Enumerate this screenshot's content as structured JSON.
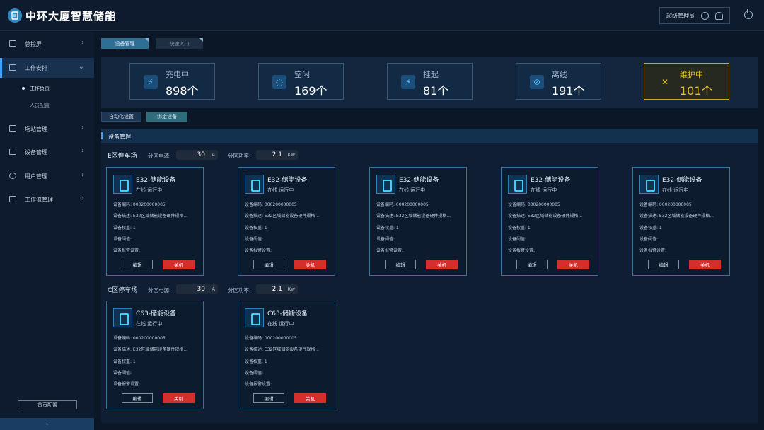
{
  "app": {
    "title": "中环大厦智慧储能"
  },
  "header": {
    "user_label": "超级管理员"
  },
  "sidebar": {
    "items": [
      {
        "label": "总控屏"
      },
      {
        "label": "工作安排"
      },
      {
        "label": "场站管理"
      },
      {
        "label": "设备管理"
      },
      {
        "label": "用户管理"
      },
      {
        "label": "工作流管理"
      }
    ],
    "subitems": [
      {
        "label": "工作负责"
      },
      {
        "label": "人员配置"
      }
    ],
    "home_config": "首页配置"
  },
  "tabs": [
    {
      "label": "设备管理"
    },
    {
      "label": "快速入口"
    }
  ],
  "stats": [
    {
      "label": "充电中",
      "value": "898个",
      "icon": "battery-charging-icon"
    },
    {
      "label": "空闲",
      "value": "169个",
      "icon": "idle-icon"
    },
    {
      "label": "挂起",
      "value": "81个",
      "icon": "suspend-icon"
    },
    {
      "label": "离线",
      "value": "191个",
      "icon": "offline-icon"
    },
    {
      "label": "维护中",
      "value": "101个",
      "icon": "maintenance-icon",
      "color": "#e0bc2a"
    }
  ],
  "actions": [
    {
      "label": "自动化设置"
    },
    {
      "label": "绑定设备"
    }
  ],
  "panel": {
    "title": "设备管理"
  },
  "zones": [
    {
      "name": "E区停车场",
      "power_source_label": "分区电源:",
      "power_source_value": "30",
      "power_source_unit": "A",
      "power_label": "分区功率:",
      "power_value": "2.1",
      "power_unit": "Kw",
      "devices": [
        {
          "name": "E32-储能设备",
          "status": "在线  运行中",
          "code": "设备编码: 000200000005",
          "desc": "设备描述: E32区域储能设备硬件规格...",
          "weight": "设备权重: 1",
          "threshold": "设备阈值:",
          "alarm": "设备报警设置:",
          "edit": "编辑",
          "off": "关机"
        },
        {
          "name": "E32-储能设备",
          "status": "在线  运行中",
          "code": "设备编码: 000200000005",
          "desc": "设备描述: E32区域储能设备硬件规格...",
          "weight": "设备权重: 1",
          "threshold": "设备阈值:",
          "alarm": "设备报警设置:",
          "edit": "编辑",
          "off": "关机"
        },
        {
          "name": "E32-储能设备",
          "status": "在线  运行中",
          "code": "设备编码: 000200000005",
          "desc": "设备描述: E32区域储能设备硬件规格...",
          "weight": "设备权重: 1",
          "threshold": "设备阈值:",
          "alarm": "设备报警设置:",
          "edit": "编辑",
          "off": "关机"
        },
        {
          "name": "E32-储能设备",
          "status": "在线  运行中",
          "code": "设备编码: 000200000005",
          "desc": "设备描述: E32区域储能设备硬件规格...",
          "weight": "设备权重: 1",
          "threshold": "设备阈值:",
          "alarm": "设备报警设置:",
          "edit": "编辑",
          "off": "关机"
        },
        {
          "name": "E32-储能设备",
          "status": "在线  运行中",
          "code": "设备编码: 000200000005",
          "desc": "设备描述: E32区域储能设备硬件规格...",
          "weight": "设备权重: 1",
          "threshold": "设备阈值:",
          "alarm": "设备报警设置:",
          "edit": "编辑",
          "off": "关机"
        }
      ]
    },
    {
      "name": "C区停车场",
      "power_source_label": "分区电源:",
      "power_source_value": "30",
      "power_source_unit": "A",
      "power_label": "分区功率:",
      "power_value": "2.1",
      "power_unit": "Kw",
      "devices": [
        {
          "name": "C63-储能设备",
          "status": "在线  运行中",
          "code": "设备编码: 000200000005",
          "desc": "设备描述: E32区域储能设备硬件规格...",
          "weight": "设备权重: 1",
          "threshold": "设备阈值:",
          "alarm": "设备报警设置:",
          "edit": "编辑",
          "off": "关机"
        },
        {
          "name": "C63-储能设备",
          "status": "在线  运行中",
          "code": "设备编码: 000200000005",
          "desc": "设备描述: E32区域储能设备硬件规格...",
          "weight": "设备权重: 1",
          "threshold": "设备阈值:",
          "alarm": "设备报警设置:",
          "edit": "编辑",
          "off": "关机"
        }
      ]
    }
  ]
}
